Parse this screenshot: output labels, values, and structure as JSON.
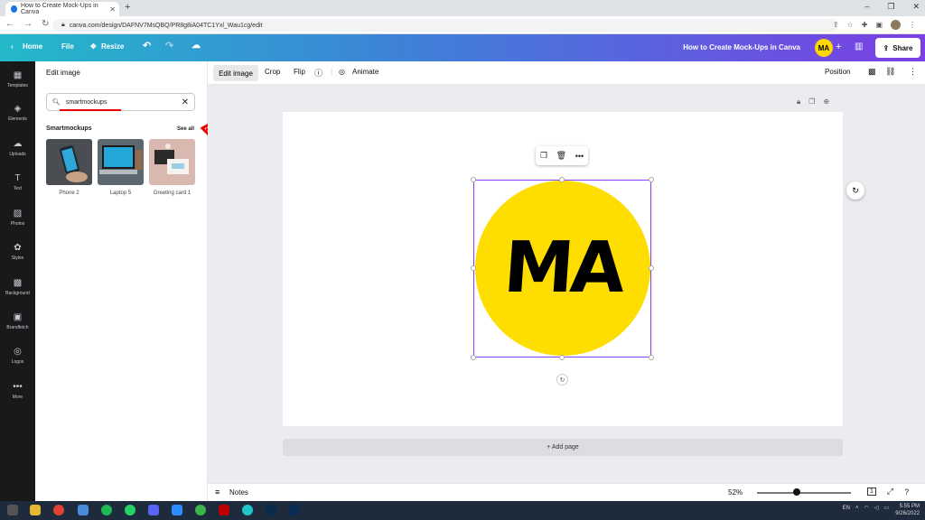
{
  "browser": {
    "tab_title": "How to Create Mock-Ups in Canva",
    "new_tab": "+",
    "url": "canva.com/design/DAFNV7MsQBQ/PR8g8iA04TC1Yxl_Wau1cg/edit",
    "win_controls": [
      "–",
      "❐",
      "✕"
    ]
  },
  "header": {
    "home": "Home",
    "file": "File",
    "resize": "Resize",
    "doc_title": "How to Create Mock-Ups in Canva",
    "avatar_initials": "MA",
    "share": "Share",
    "colors": {
      "gradient_start": "#23b9c9",
      "gradient_end": "#7b3fe4"
    }
  },
  "rail": [
    {
      "icon": "templates-icon",
      "label": "Templates"
    },
    {
      "icon": "elements-icon",
      "label": "Elements"
    },
    {
      "icon": "uploads-icon",
      "label": "Uploads"
    },
    {
      "icon": "text-icon",
      "label": "Text"
    },
    {
      "icon": "photos-icon",
      "label": "Photos"
    },
    {
      "icon": "styles-icon",
      "label": "Styles"
    },
    {
      "icon": "background-icon",
      "label": "Background"
    },
    {
      "icon": "brandfetch-icon",
      "label": "Brandfetch"
    },
    {
      "icon": "logos-icon",
      "label": "Logos"
    },
    {
      "icon": "more-icon",
      "label": "More"
    }
  ],
  "panel": {
    "title": "Edit image",
    "search_value": "smartmockups",
    "section_title": "Smartmockups",
    "see_all": "See all",
    "mockups": [
      {
        "label": "Phone 2"
      },
      {
        "label": "Laptop 5"
      },
      {
        "label": "Greeting card 1"
      }
    ]
  },
  "toolbar": {
    "edit_image": "Edit image",
    "crop": "Crop",
    "flip": "Flip",
    "animate": "Animate",
    "position": "Position"
  },
  "canvas": {
    "logo_text": "MA",
    "logo_color": "#fedd00",
    "add_page": "+ Add page"
  },
  "bottom": {
    "notes": "Notes",
    "zoom": "52%",
    "zoom_fraction": 0.42,
    "page_count": "1"
  },
  "taskbar": {
    "lang": "EN",
    "time": "5:55 PM",
    "date": "9/26/2022"
  }
}
